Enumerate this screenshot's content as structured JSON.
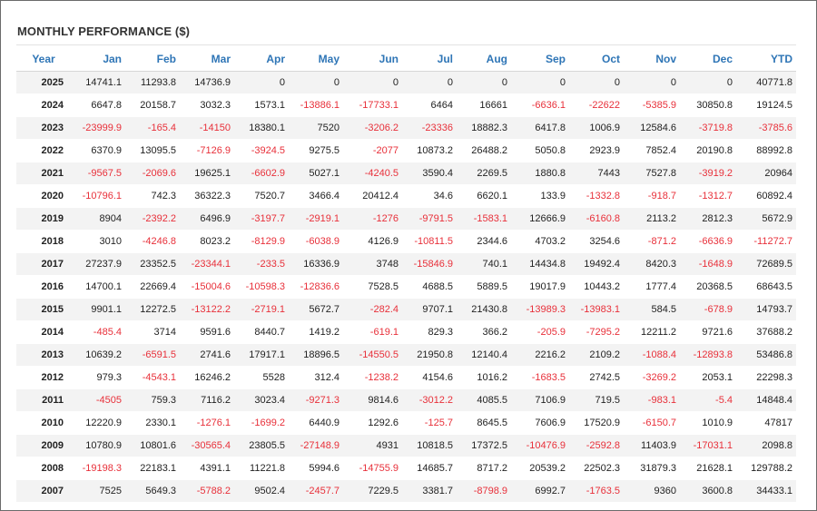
{
  "title": "MONTHLY PERFORMANCE ($)",
  "colors": {
    "header": "#2e75b6",
    "negative": "#e8303a",
    "stripe": "#f3f3f3"
  },
  "columns": [
    "Year",
    "Jan",
    "Feb",
    "Mar",
    "Apr",
    "May",
    "Jun",
    "Jul",
    "Aug",
    "Sep",
    "Oct",
    "Nov",
    "Dec",
    "YTD"
  ],
  "rows": [
    [
      "2025",
      "14741.1",
      "11293.8",
      "14736.9",
      "0",
      "0",
      "0",
      "0",
      "0",
      "0",
      "0",
      "0",
      "0",
      "40771.8"
    ],
    [
      "2024",
      "6647.8",
      "20158.7",
      "3032.3",
      "1573.1",
      "-13886.1",
      "-17733.1",
      "6464",
      "16661",
      "-6636.1",
      "-22622",
      "-5385.9",
      "30850.8",
      "19124.5"
    ],
    [
      "2023",
      "-23999.9",
      "-165.4",
      "-14150",
      "18380.1",
      "7520",
      "-3206.2",
      "-23336",
      "18882.3",
      "6417.8",
      "1006.9",
      "12584.6",
      "-3719.8",
      "-3785.6"
    ],
    [
      "2022",
      "6370.9",
      "13095.5",
      "-7126.9",
      "-3924.5",
      "9275.5",
      "-2077",
      "10873.2",
      "26488.2",
      "5050.8",
      "2923.9",
      "7852.4",
      "20190.8",
      "88992.8"
    ],
    [
      "2021",
      "-9567.5",
      "-2069.6",
      "19625.1",
      "-6602.9",
      "5027.1",
      "-4240.5",
      "3590.4",
      "2269.5",
      "1880.8",
      "7443",
      "7527.8",
      "-3919.2",
      "20964"
    ],
    [
      "2020",
      "-10796.1",
      "742.3",
      "36322.3",
      "7520.7",
      "3466.4",
      "20412.4",
      "34.6",
      "6620.1",
      "133.9",
      "-1332.8",
      "-918.7",
      "-1312.7",
      "60892.4"
    ],
    [
      "2019",
      "8904",
      "-2392.2",
      "6496.9",
      "-3197.7",
      "-2919.1",
      "-1276",
      "-9791.5",
      "-1583.1",
      "12666.9",
      "-6160.8",
      "2113.2",
      "2812.3",
      "5672.9"
    ],
    [
      "2018",
      "3010",
      "-4246.8",
      "8023.2",
      "-8129.9",
      "-6038.9",
      "4126.9",
      "-10811.5",
      "2344.6",
      "4703.2",
      "3254.6",
      "-871.2",
      "-6636.9",
      "-11272.7"
    ],
    [
      "2017",
      "27237.9",
      "23352.5",
      "-23344.1",
      "-233.5",
      "16336.9",
      "3748",
      "-15846.9",
      "740.1",
      "14434.8",
      "19492.4",
      "8420.3",
      "-1648.9",
      "72689.5"
    ],
    [
      "2016",
      "14700.1",
      "22669.4",
      "-15004.6",
      "-10598.3",
      "-12836.6",
      "7528.5",
      "4688.5",
      "5889.5",
      "19017.9",
      "10443.2",
      "1777.4",
      "20368.5",
      "68643.5"
    ],
    [
      "2015",
      "9901.1",
      "12272.5",
      "-13122.2",
      "-2719.1",
      "5672.7",
      "-282.4",
      "9707.1",
      "21430.8",
      "-13989.3",
      "-13983.1",
      "584.5",
      "-678.9",
      "14793.7"
    ],
    [
      "2014",
      "-485.4",
      "3714",
      "9591.6",
      "8440.7",
      "1419.2",
      "-619.1",
      "829.3",
      "366.2",
      "-205.9",
      "-7295.2",
      "12211.2",
      "9721.6",
      "37688.2"
    ],
    [
      "2013",
      "10639.2",
      "-6591.5",
      "2741.6",
      "17917.1",
      "18896.5",
      "-14550.5",
      "21950.8",
      "12140.4",
      "2216.2",
      "2109.2",
      "-1088.4",
      "-12893.8",
      "53486.8"
    ],
    [
      "2012",
      "979.3",
      "-4543.1",
      "16246.2",
      "5528",
      "312.4",
      "-1238.2",
      "4154.6",
      "1016.2",
      "-1683.5",
      "2742.5",
      "-3269.2",
      "2053.1",
      "22298.3"
    ],
    [
      "2011",
      "-4505",
      "759.3",
      "7116.2",
      "3023.4",
      "-9271.3",
      "9814.6",
      "-3012.2",
      "4085.5",
      "7106.9",
      "719.5",
      "-983.1",
      "-5.4",
      "14848.4"
    ],
    [
      "2010",
      "12220.9",
      "2330.1",
      "-1276.1",
      "-1699.2",
      "6440.9",
      "1292.6",
      "-125.7",
      "8645.5",
      "7606.9",
      "17520.9",
      "-6150.7",
      "1010.9",
      "47817"
    ],
    [
      "2009",
      "10780.9",
      "10801.6",
      "-30565.4",
      "23805.5",
      "-27148.9",
      "4931",
      "10818.5",
      "17372.5",
      "-10476.9",
      "-2592.8",
      "11403.9",
      "-17031.1",
      "2098.8"
    ],
    [
      "2008",
      "-19198.3",
      "22183.1",
      "4391.1",
      "11221.8",
      "5994.6",
      "-14755.9",
      "14685.7",
      "8717.2",
      "20539.2",
      "22502.3",
      "31879.3",
      "21628.1",
      "129788.2"
    ],
    [
      "2007",
      "7525",
      "5649.3",
      "-5788.2",
      "9502.4",
      "-2457.7",
      "7229.5",
      "3381.7",
      "-8798.9",
      "6992.7",
      "-1763.5",
      "9360",
      "3600.8",
      "34433.1"
    ]
  ]
}
